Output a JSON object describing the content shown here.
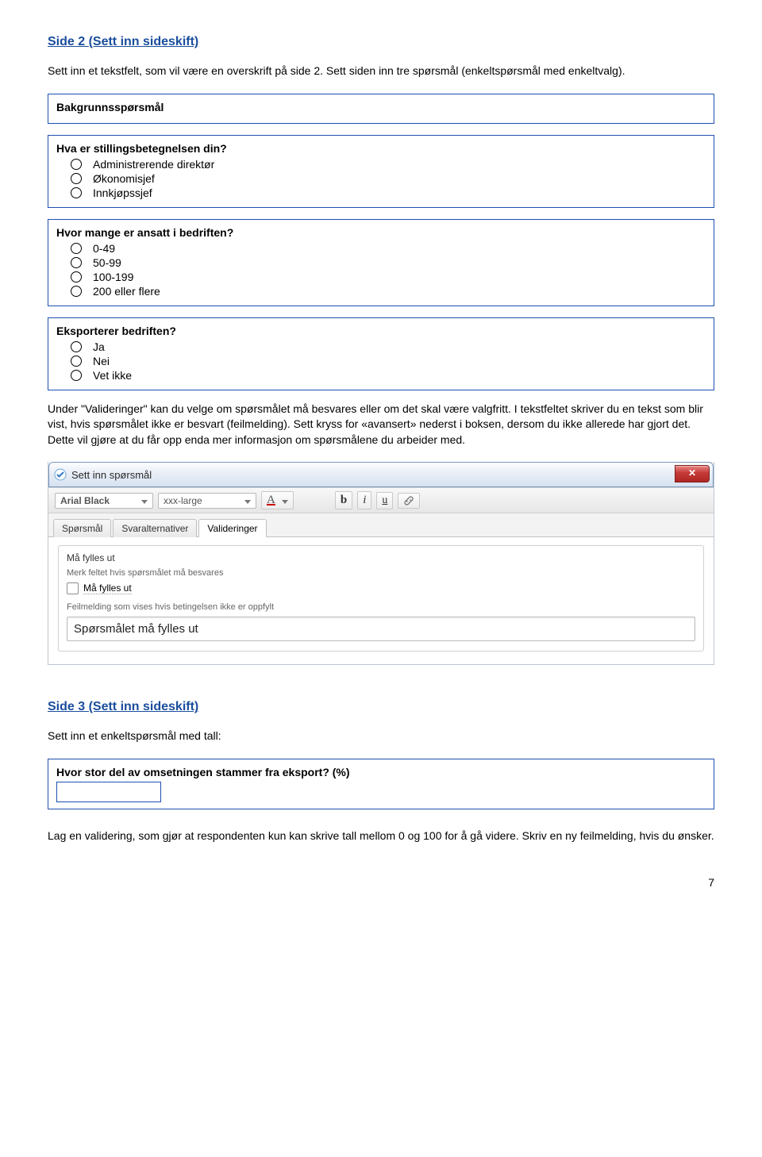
{
  "side2": {
    "heading": "Side 2 (Sett inn sideskift)",
    "intro": "Sett inn et tekstfelt, som vil være en overskrift på side 2. Sett siden inn tre spørsmål (enkeltspørsmål med enkeltvalg).",
    "q_bg_title": "Bakgrunnsspørsmål",
    "q1": {
      "title": "Hva er stillingsbetegnelsen din?",
      "options": [
        "Administrerende direktør",
        "Økonomisjef",
        "Innkjøpssjef"
      ]
    },
    "q2": {
      "title": "Hvor mange er ansatt i bedriften?",
      "options": [
        "0-49",
        "50-99",
        "100-199",
        "200 eller flere"
      ]
    },
    "q3": {
      "title": "Eksporterer bedriften?",
      "options": [
        "Ja",
        "Nei",
        "Vet ikke"
      ]
    },
    "explain": "Under \"Valideringer\" kan du velge om spørsmålet må besvares eller om det skal være valgfritt. I tekstfeltet skriver du en tekst som blir vist, hvis spørsmålet ikke er besvart (feilmelding). Sett kryss for «avansert» nederst i boksen, dersom du ikke allerede har gjort det. Dette vil gjøre at du får opp enda mer informasjon om spørsmålene du arbeider med."
  },
  "window": {
    "title": "Sett inn spørsmål",
    "font_select": "Arial Black",
    "size_select": "xxx-large",
    "color_label": "A",
    "bold": "b",
    "italic": "i",
    "underline": "u",
    "tabs": [
      "Spørsmål",
      "Svaralternativer",
      "Valideringer"
    ],
    "active_tab": 2,
    "panel": {
      "section_title": "Må fylles ut",
      "section_sub": "Merk feltet hvis spørsmålet må besvares",
      "checkbox_label": "Må fylles ut",
      "error_label": "Feilmelding som vises hvis betingelsen ikke er oppfylt",
      "error_value": "Spørsmålet må fylles ut"
    }
  },
  "side3": {
    "heading": "Side 3 (Sett inn sideskift)",
    "intro": "Sett inn et enkeltspørsmål med tall:",
    "q_title": "Hvor stor del av omsetningen stammer fra eksport? (%)",
    "outro": "Lag en validering, som gjør at respondenten kun kan skrive tall mellom 0 og 100 for å gå videre. Skriv en ny feilmelding, hvis du ønsker."
  },
  "page_number": "7"
}
